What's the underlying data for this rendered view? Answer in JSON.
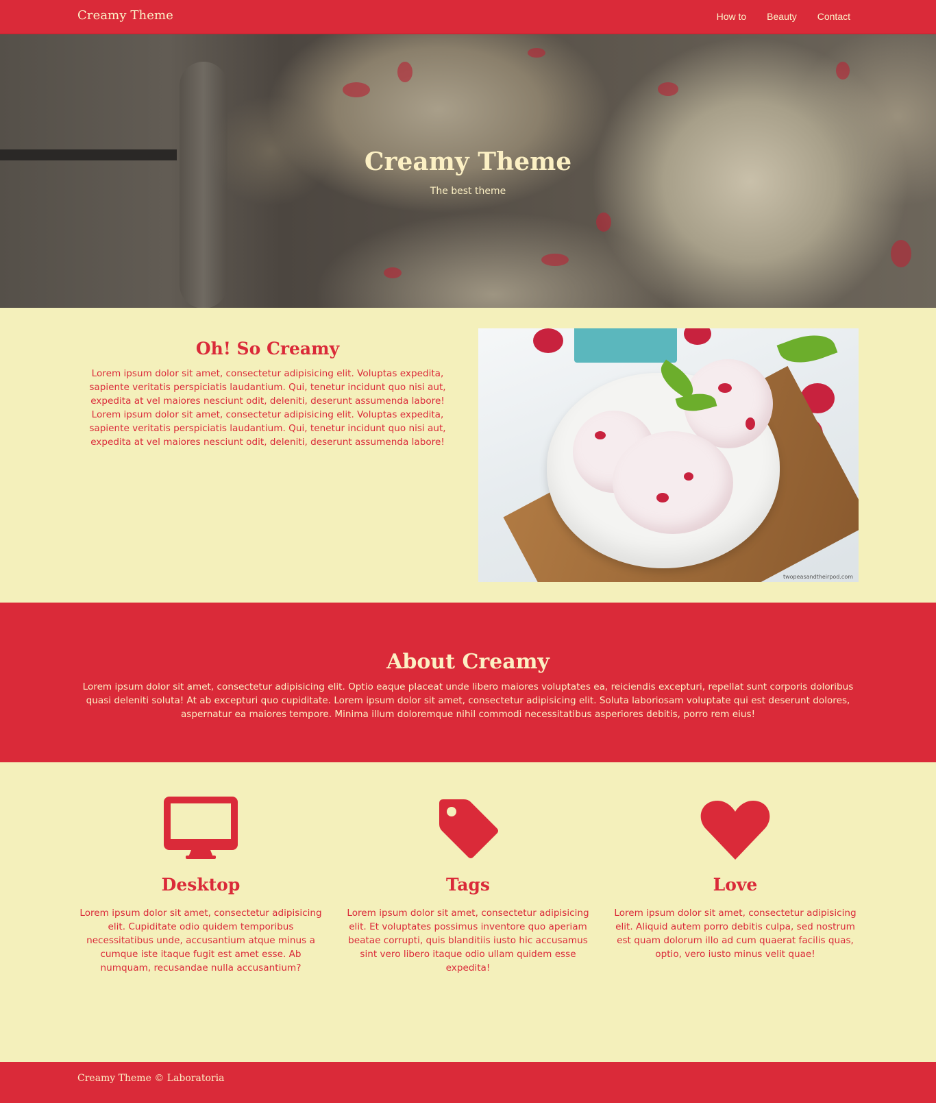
{
  "navbar": {
    "brand": "Creamy Theme",
    "links": [
      "How to",
      "Beauty",
      "Contact"
    ]
  },
  "hero": {
    "title": "Creamy Theme",
    "subtitle": "The best theme"
  },
  "feature": {
    "heading": "Oh! So Creamy",
    "text": "Lorem ipsum dolor sit amet, consectetur adipisicing elit. Voluptas expedita, sapiente veritatis perspiciatis laudantium. Qui, tenetur incidunt quo nisi aut, expedita at vel maiores nesciunt odit, deleniti, deserunt assumenda labore! Lorem ipsum dolor sit amet, consectetur adipisicing elit. Voluptas expedita, sapiente veritatis perspiciatis laudantium. Qui, tenetur incidunt quo nisi aut, expedita at vel maiores nesciunt odit, deleniti, deserunt assumenda labore!",
    "image_caption": "twopeasandtheirpod.com"
  },
  "about": {
    "heading": "About Creamy",
    "text": "Lorem ipsum dolor sit amet, consectetur adipisicing elit. Optio eaque placeat unde libero maiores voluptates ea, reiciendis excepturi, repellat sunt corporis doloribus quasi deleniti soluta! At ab excepturi quo cupiditate. Lorem ipsum dolor sit amet, consectetur adipisicing elit. Soluta laboriosam voluptate qui est deserunt dolores, aspernatur ea maiores tempore. Minima illum doloremque nihil commodi necessitatibus asperiores debitis, porro rem eius!"
  },
  "columns": [
    {
      "icon": "desktop-icon",
      "title": "Desktop",
      "text": "Lorem ipsum dolor sit amet, consectetur adipisicing elit. Cupiditate odio quidem temporibus necessitatibus unde, accusantium atque minus a cumque iste itaque fugit est amet esse. Ab numquam, recusandae nulla accusantium?"
    },
    {
      "icon": "tag-icon",
      "title": "Tags",
      "text": "Lorem ipsum dolor sit amet, consectetur adipisicing elit. Et voluptates possimus inventore quo aperiam beatae corrupti, quis blanditiis iusto hic accusamus sint vero libero itaque odio ullam quidem esse expedita!"
    },
    {
      "icon": "heart-icon",
      "title": "Love",
      "text": "Lorem ipsum dolor sit amet, consectetur adipisicing elit. Aliquid autem porro debitis culpa, sed nostrum est quam dolorum illo ad cum quaerat facilis quas, optio, vero iusto minus velit quae!"
    }
  ],
  "footer": {
    "text": "Creamy Theme © Laboratoria"
  },
  "colors": {
    "accent": "#da2a39",
    "cream": "#f4f0bb",
    "light_text": "#fcf0c4"
  }
}
